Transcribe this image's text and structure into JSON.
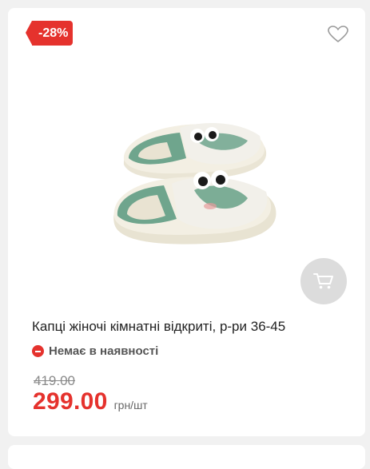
{
  "product": {
    "discount_badge": "-28%",
    "title": "Капці жіночі кімнатні відкриті, р-ри 36-45",
    "availability": "Немає в наявності",
    "old_price": "419.00",
    "price": "299.00",
    "price_unit": "грн/шт"
  },
  "icons": {
    "favorite": "heart-outline-icon",
    "cart": "shopping-cart-icon",
    "availability": "stop-circle-icon"
  },
  "colors": {
    "accent_red": "#e5322d",
    "slipper_green": "#6fa58d",
    "slipper_cream": "#f3efe3",
    "cart_button_bg": "#dcdcdc"
  }
}
